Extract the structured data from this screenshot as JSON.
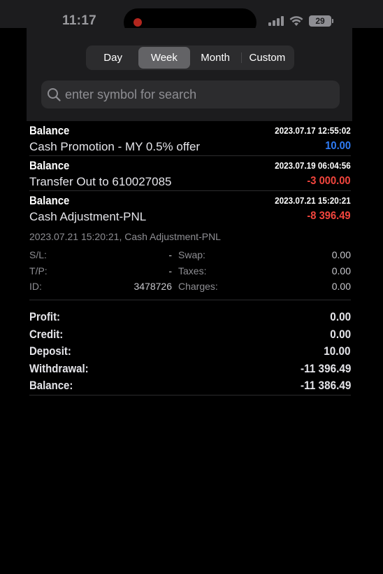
{
  "status_bar": {
    "time": "11:17",
    "battery": "29"
  },
  "period_tabs": [
    "Day",
    "Week",
    "Month",
    "Custom"
  ],
  "active_tab": "Week",
  "search": {
    "placeholder": "enter symbol for search"
  },
  "transactions": [
    {
      "type": "Balance",
      "date": "2023.07.17 12:55:02",
      "comment": "Cash Promotion - MY 0.5% offer",
      "amount": "10.00",
      "sign": "positive"
    },
    {
      "type": "Balance",
      "date": "2023.07.19 06:04:56",
      "comment": "Transfer Out to 610027085",
      "amount": "-3 000.00",
      "sign": "negative"
    },
    {
      "type": "Balance",
      "date": "2023.07.21 15:20:21",
      "comment": "Cash Adjustment-PNL",
      "amount": "-8 396.49",
      "sign": "negative"
    }
  ],
  "details": {
    "title": "2023.07.21 15:20:21, Cash Adjustment-PNL",
    "sl_label": "S/L:",
    "sl_value": "-",
    "tp_label": "T/P:",
    "tp_value": "-",
    "id_label": "ID:",
    "id_value": "3478726",
    "swap_label": "Swap:",
    "swap_value": "0.00",
    "taxes_label": "Taxes:",
    "taxes_value": "0.00",
    "charges_label": "Charges:",
    "charges_value": "0.00"
  },
  "summary": {
    "profit_label": "Profit:",
    "profit_value": "0.00",
    "credit_label": "Credit:",
    "credit_value": "0.00",
    "deposit_label": "Deposit:",
    "deposit_value": "10.00",
    "withdrawal_label": "Withdrawal:",
    "withdrawal_value": "-11 396.49",
    "balance_label": "Balance:",
    "balance_value": "-11 386.49"
  },
  "colors": {
    "positive": "#2f7cf6",
    "negative": "#f2453d",
    "background": "#000000",
    "panel": "#1c1c1e"
  }
}
